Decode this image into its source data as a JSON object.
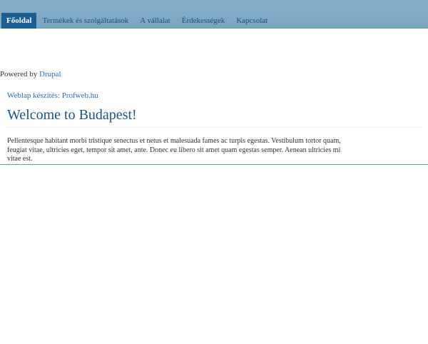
{
  "nav": {
    "items": [
      {
        "label": "Főoldal",
        "active": true
      },
      {
        "label": "Termékek és szolgáltatások",
        "active": false
      },
      {
        "label": "A vállalat",
        "active": false
      },
      {
        "label": "Érdekességek",
        "active": false
      },
      {
        "label": "Kapcsolat",
        "active": false
      }
    ]
  },
  "footer": {
    "powered_prefix": "Powered by ",
    "powered_link": "Drupal"
  },
  "credit": {
    "prefix": "Weblap készítés: ",
    "link": "Profweb.hu"
  },
  "main": {
    "title": "Welcome to Budapest!",
    "body": "Pellentesque habitant morbi tristique senectus et netus et malesuada fames ac turpis egestas. Vestibulum tortor quam, feugiat vitae, ultricies eget, tempor sit amet, ante. Donec eu libero sit amet quam egestas semper. Aenean ultricies mi vitae est."
  },
  "colors": {
    "nav_bg": "#7aa6c2",
    "nav_active_bg": "#1a5f93",
    "link": "#2a6db0",
    "title": "#1a5485"
  }
}
